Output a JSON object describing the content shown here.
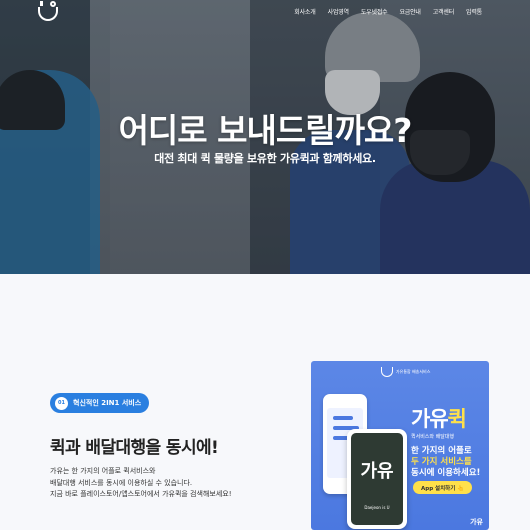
{
  "nav": {
    "logo_icon": "gayu-smile-logo",
    "menu": [
      "회사소개",
      "사업영역",
      "도우넷접수",
      "요금안내",
      "고객센터",
      "입력톰"
    ]
  },
  "hero": {
    "title": "어디로 보내드릴까요?",
    "subtitle": "대전 최대 퀵 물량을 보유한 가유퀵과 함께하세요."
  },
  "section": {
    "badge_num": "01",
    "badge_text": "혁신적인 2IN1 서비스",
    "title": "퀵과 배달대행을 동시에!",
    "desc": [
      "가유는 한 가지의 어플로 퀵서비스와",
      "배달대행 서비스를 동시에 이용하실 수 있습니다.",
      "지금 바로 플레이스토어/앱스토어에서 가유퀵을 검색해보세요!"
    ]
  },
  "promo": {
    "logo_text": "가유통합 배송서비스",
    "phone_big": "가유",
    "phone_caption": "Daejeon is U",
    "brand_main": "가유",
    "brand_accent": "퀵",
    "small": "퀵서비스와 배달대행",
    "line1": "한 가지의 어플로",
    "line2": "두 가지 서비스를",
    "line3": "동시에 이용하세요!",
    "app_button": "App 설치하기 👆",
    "corner": "가유",
    "colors": {
      "bg": "#4b78e0",
      "accent": "#ffe04a"
    }
  }
}
